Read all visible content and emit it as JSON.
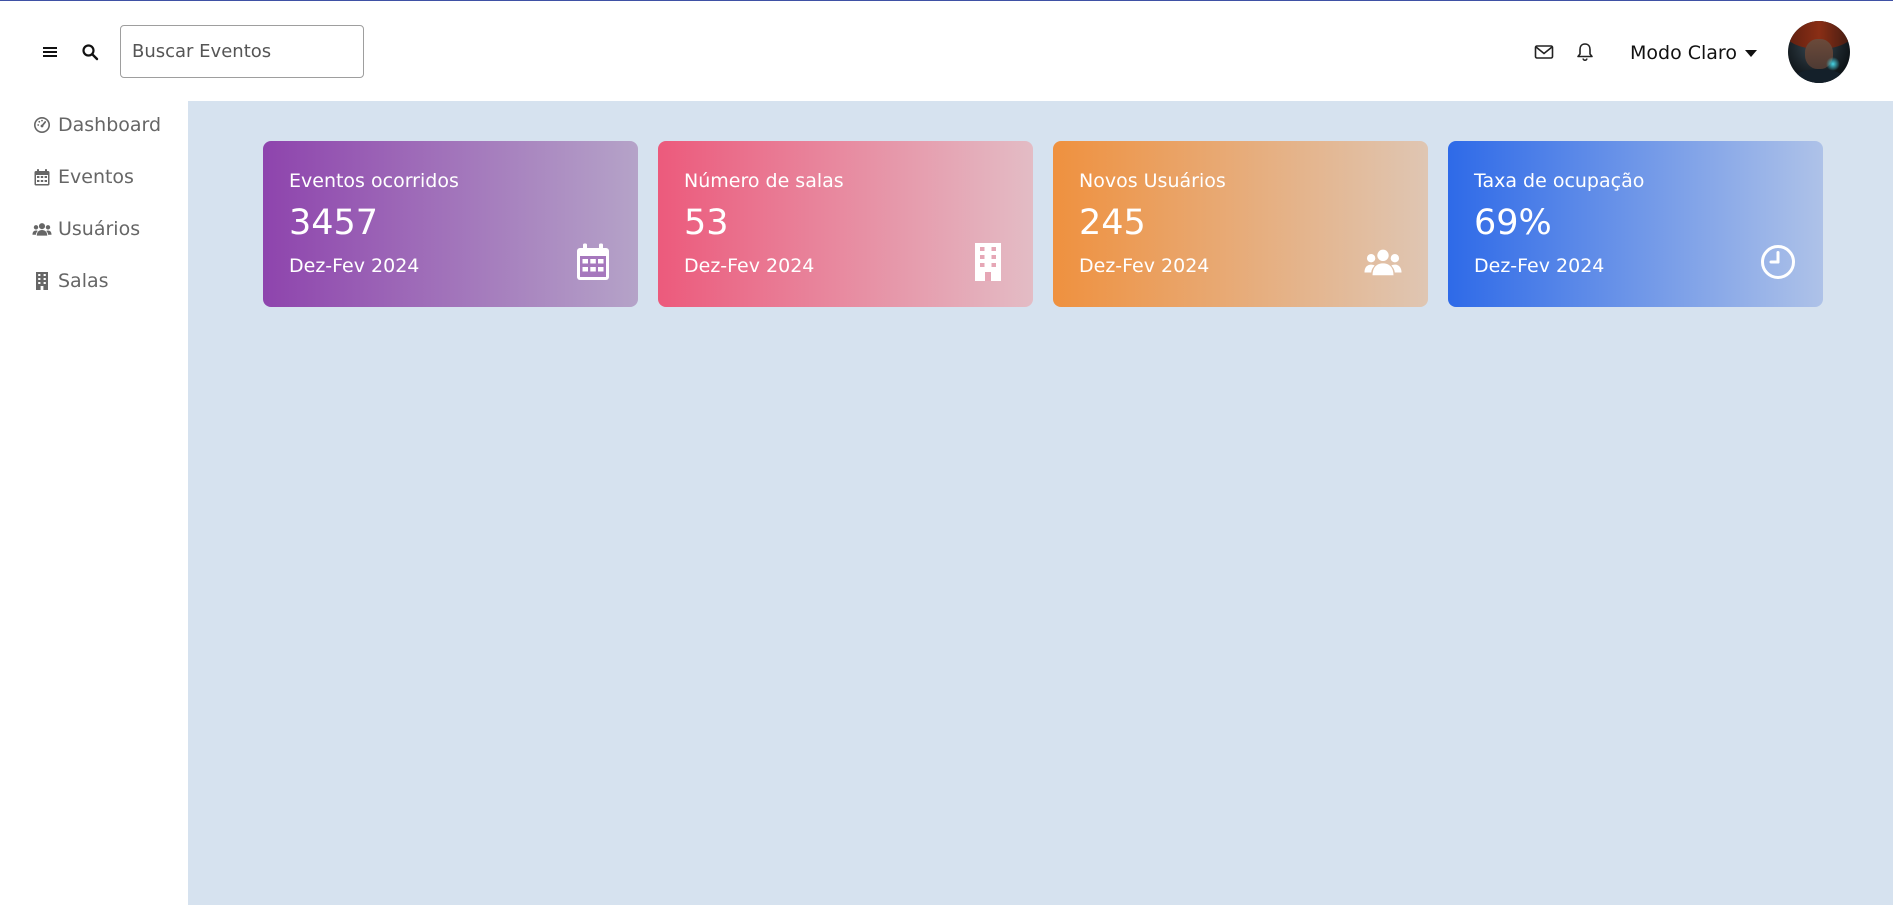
{
  "header": {
    "search_placeholder": "Buscar Eventos",
    "mode_label": "Modo Claro",
    "icons": [
      "menu-icon",
      "search-icon",
      "mail-icon",
      "bell-icon"
    ]
  },
  "sidebar": {
    "items": [
      {
        "label": "Dashboard",
        "icon": "gauge-icon"
      },
      {
        "label": "Eventos",
        "icon": "calendar-icon"
      },
      {
        "label": "Usuários",
        "icon": "users-icon"
      },
      {
        "label": "Salas",
        "icon": "building-icon"
      }
    ]
  },
  "cards": [
    {
      "title": "Eventos ocorridos",
      "value": "3457",
      "period": "Dez-Fev 2024",
      "icon": "calendar-icon",
      "colors": [
        "#8e44ad",
        "#b5a3c8"
      ]
    },
    {
      "title": "Número de salas",
      "value": "53",
      "period": "Dez-Fev 2024",
      "icon": "building-icon",
      "colors": [
        "#ec5a7c",
        "#e3bcc5"
      ]
    },
    {
      "title": "Novos Usuários",
      "value": "245",
      "period": "Dez-Fev 2024",
      "icon": "users-icon",
      "colors": [
        "#ef913f",
        "#dfc6b3"
      ]
    },
    {
      "title": "Taxa de ocupação",
      "value": "69%",
      "period": "Dez-Fev 2024",
      "icon": "clock-icon",
      "colors": [
        "#2e6ae8",
        "#aec2e8"
      ]
    }
  ],
  "colors": {
    "content_bg": "#d6e2ef",
    "sidebar_text": "#666666",
    "top_line": "#3f51a5"
  }
}
